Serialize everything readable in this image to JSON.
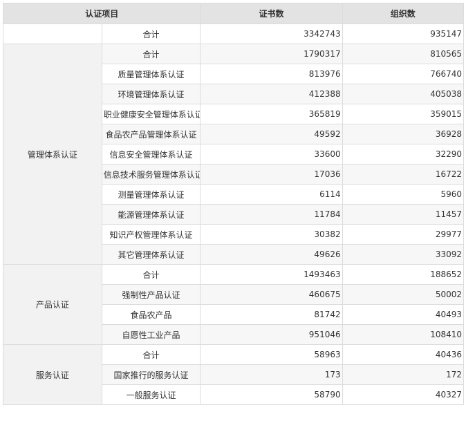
{
  "header": {
    "item": "认证项目",
    "certificates": "证书数",
    "organizations": "组织数"
  },
  "grand_total": {
    "label": "合计",
    "certificates": "3342743",
    "organizations": "935147"
  },
  "groups": [
    {
      "name": "管理体系认证",
      "rows": [
        {
          "label": "合计",
          "certificates": "1790317",
          "organizations": "810565"
        },
        {
          "label": "质量管理体系认证",
          "certificates": "813976",
          "organizations": "766740"
        },
        {
          "label": "环境管理体系认证",
          "certificates": "412388",
          "organizations": "405038"
        },
        {
          "label": "职业健康安全管理体系认证",
          "certificates": "365819",
          "organizations": "359015"
        },
        {
          "label": "食品农产品管理体系认证",
          "certificates": "49592",
          "organizations": "36928"
        },
        {
          "label": "信息安全管理体系认证",
          "certificates": "33600",
          "organizations": "32290"
        },
        {
          "label": "信息技术服务管理体系认证",
          "certificates": "17036",
          "organizations": "16722"
        },
        {
          "label": "测量管理体系认证",
          "certificates": "6114",
          "organizations": "5960"
        },
        {
          "label": "能源管理体系认证",
          "certificates": "11784",
          "organizations": "11457"
        },
        {
          "label": "知识产权管理体系认证",
          "certificates": "30382",
          "organizations": "29977"
        },
        {
          "label": "其它管理体系认证",
          "certificates": "49626",
          "organizations": "33092"
        }
      ]
    },
    {
      "name": "产品认证",
      "rows": [
        {
          "label": "合计",
          "certificates": "1493463",
          "organizations": "188652"
        },
        {
          "label": "强制性产品认证",
          "certificates": "460675",
          "organizations": "50002"
        },
        {
          "label": "食品农产品",
          "certificates": "81742",
          "organizations": "40493"
        },
        {
          "label": "自愿性工业产品",
          "certificates": "951046",
          "organizations": "108410"
        }
      ]
    },
    {
      "name": "服务认证",
      "rows": [
        {
          "label": "合计",
          "certificates": "58963",
          "organizations": "40436"
        },
        {
          "label": "国家推行的服务认证",
          "certificates": "173",
          "organizations": "172"
        },
        {
          "label": "一般服务认证",
          "certificates": "58790",
          "organizations": "40327"
        }
      ]
    }
  ]
}
